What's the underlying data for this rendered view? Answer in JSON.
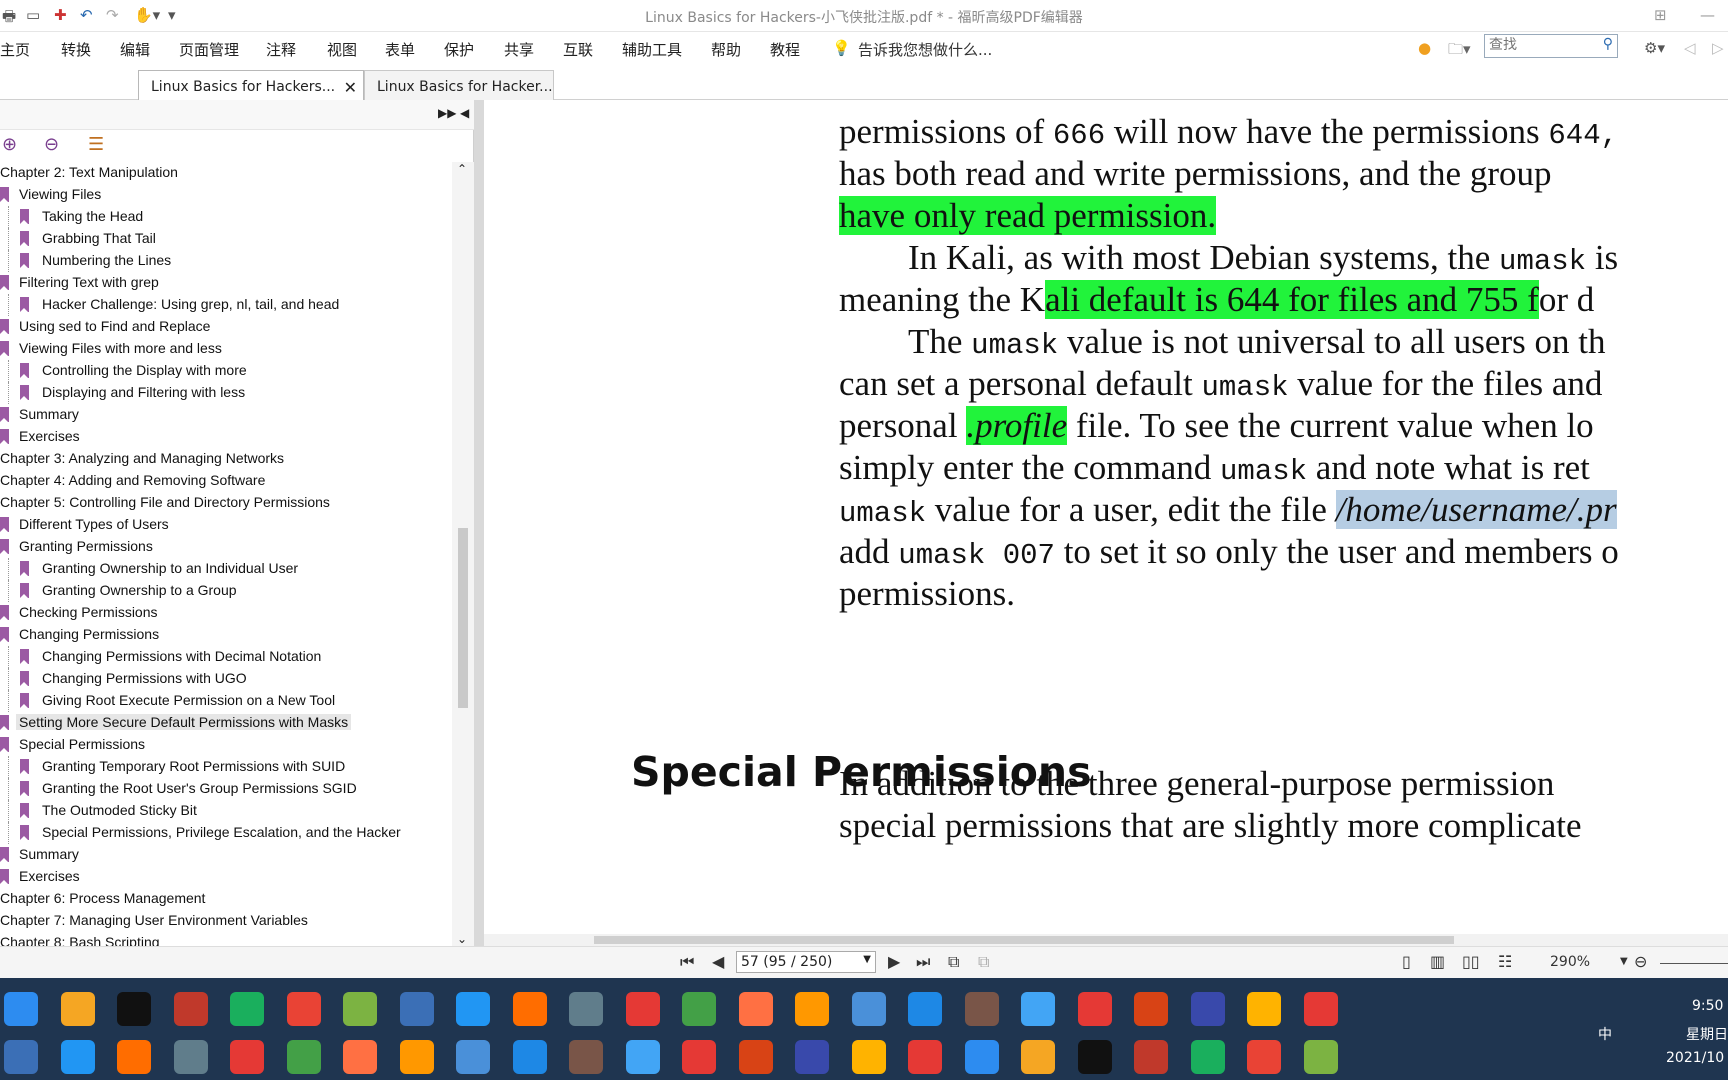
{
  "window_title": "Linux Basics for Hackers-小飞侠批注版.pdf * - 福昕高级PDF编辑器",
  "menu": [
    "主页",
    "转换",
    "编辑",
    "页面管理",
    "注释",
    "视图",
    "表单",
    "保护",
    "共享",
    "互联",
    "辅助工具",
    "帮助",
    "教程"
  ],
  "tell_me": "告诉我您想做什么...",
  "search_placeholder": "查找",
  "tabs": [
    {
      "label": "Linux Basics for Hackers...",
      "active": true
    },
    {
      "label": "Linux Basics for Hacker...",
      "active": false
    }
  ],
  "bookmarks": [
    {
      "label": "Chapter 2: Text Manipulation",
      "level": 0
    },
    {
      "label": "Viewing Files",
      "level": 1
    },
    {
      "label": "Taking the Head",
      "level": 2
    },
    {
      "label": "Grabbing That Tail",
      "level": 2
    },
    {
      "label": "Numbering the Lines",
      "level": 2
    },
    {
      "label": "Filtering Text with grep",
      "level": 1
    },
    {
      "label": "Hacker Challenge: Using grep, nl, tail, and head",
      "level": 2
    },
    {
      "label": "Using sed to Find and Replace",
      "level": 1
    },
    {
      "label": "Viewing Files with more and less",
      "level": 1
    },
    {
      "label": "Controlling the Display with more",
      "level": 2
    },
    {
      "label": "Displaying and Filtering with less",
      "level": 2
    },
    {
      "label": "Summary",
      "level": 1
    },
    {
      "label": "Exercises",
      "level": 1
    },
    {
      "label": "Chapter 3: Analyzing and Managing Networks",
      "level": 0
    },
    {
      "label": "Chapter 4: Adding and Removing Software",
      "level": 0
    },
    {
      "label": "Chapter 5: Controlling File and Directory Permissions",
      "level": 0
    },
    {
      "label": "Different Types of Users",
      "level": 1
    },
    {
      "label": "Granting Permissions",
      "level": 1
    },
    {
      "label": "Granting Ownership to an Individual User",
      "level": 2
    },
    {
      "label": "Granting Ownership to a Group",
      "level": 2
    },
    {
      "label": "Checking Permissions",
      "level": 1
    },
    {
      "label": "Changing Permissions",
      "level": 1
    },
    {
      "label": "Changing Permissions with Decimal Notation",
      "level": 2
    },
    {
      "label": "Changing Permissions with UGO",
      "level": 2
    },
    {
      "label": "Giving Root Execute Permission on a New Tool",
      "level": 2
    },
    {
      "label": "Setting More Secure Default Permissions with Masks",
      "level": 1,
      "selected": true
    },
    {
      "label": "Special Permissions",
      "level": 1
    },
    {
      "label": "Granting Temporary Root Permissions with SUID",
      "level": 2
    },
    {
      "label": "Granting the Root User's Group Permissions SGID",
      "level": 2
    },
    {
      "label": "The Outmoded Sticky Bit",
      "level": 2
    },
    {
      "label": "Special Permissions, Privilege Escalation, and the Hacker",
      "level": 2
    },
    {
      "label": "Summary",
      "level": 1
    },
    {
      "label": "Exercises",
      "level": 1
    },
    {
      "label": "Chapter 6: Process Management",
      "level": 0
    },
    {
      "label": "Chapter 7: Managing User Environment Variables",
      "level": 0
    },
    {
      "label": "Chapter 8: Bash Scripting",
      "level": 0
    }
  ],
  "doc": {
    "l1a": "permissions of ",
    "l1b": "666",
    "l1c": " will now have the permissions ",
    "l1d": "644,",
    "l2": "has both read and write permissions, and the group",
    "l3": "have only read permission.",
    "l4a": "In Kali, as with most Debian systems, the ",
    "l4b": "umask",
    "l4c": " is",
    "l5a": "meaning the K",
    "l5b": "ali default is 644 for files and 755 f",
    "l5c": "or d",
    "l6a": "The ",
    "l6b": "umask",
    "l6c": " value is not universal to all users on th",
    "l7a": "can set a personal default ",
    "l7b": "umask",
    "l7c": " value for the files and",
    "l8a": "personal ",
    "l8b": ".profile",
    "l8c": " file. To see the current value when lo",
    "l9a": "simply enter the command ",
    "l9b": "umask",
    "l9c": " and note what is ret",
    "l10a": "umask",
    "l10b": " value for a user, edit the file ",
    "l10c": "/home/username/.pr",
    "l11a": "add ",
    "l11b": "umask 007",
    "l11c": " to set it so only the user and members o",
    "l12": "permissions.",
    "heading": "Special Permissions",
    "l13": "In addition to the three general-purpose permission",
    "l14": "special permissions that are slightly more complicate"
  },
  "page_field": "57 (95 / 250)",
  "zoom": "290%",
  "clock": {
    "time": "9:50",
    "day": "星期日",
    "date": "2021/10"
  },
  "ime": "中",
  "colors": {
    "highlight": "#21f33b",
    "selection": "#b6cde3",
    "bookmark": "#9b5aa3",
    "taskbar": "#1f3550"
  }
}
